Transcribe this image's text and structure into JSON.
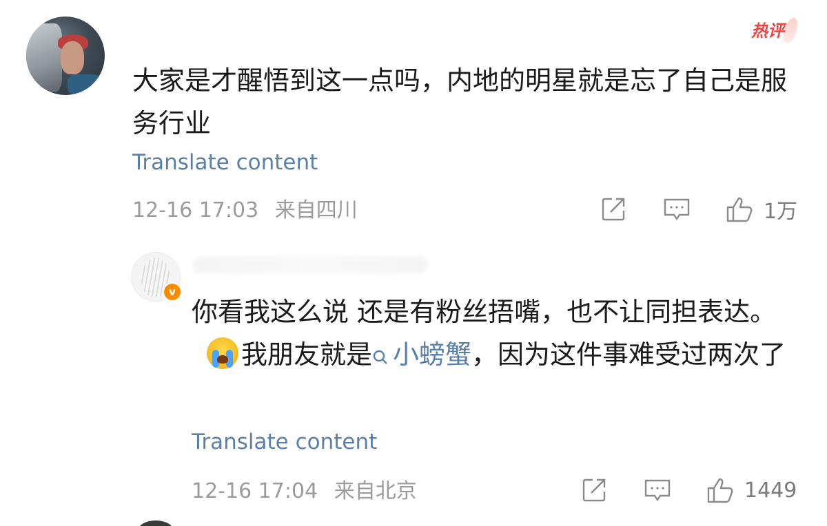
{
  "comment": {
    "hot_label": "热评",
    "text": "大家是才醒悟到这一点吗，内地的明星就是忘了自己是服务行业",
    "translate": "Translate content",
    "time": "12-16 17:03",
    "location": "来自四川",
    "likes": "1万",
    "icons": [
      "forward-icon",
      "comment-icon",
      "like-icon"
    ]
  },
  "reply": {
    "verified_badge": "v",
    "text_part1": "你看我这么说 还是有粉丝捂嘴，也不让同担表达。",
    "emoji": "crying-emoji",
    "text_part2": "我朋友就是",
    "mention": "小螃蟹",
    "text_part3": "，因为这件事难受过两次了",
    "translate": "Translate content",
    "time": "12-16 17:04",
    "location": "来自北京",
    "likes": "1449",
    "icons": [
      "forward-icon",
      "comment-icon",
      "like-icon"
    ]
  },
  "colors": {
    "link": "#5a7fa8",
    "meta": "#9b9b9b",
    "hot": "#e8463f",
    "badge": "#ff8a00"
  }
}
